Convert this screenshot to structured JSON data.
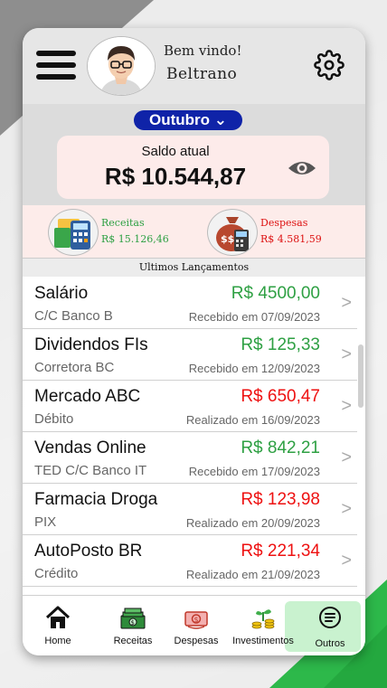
{
  "header": {
    "welcome": "Bem vindo!",
    "username": "Beltrano"
  },
  "month": {
    "label": "Outubro ⌄"
  },
  "balance": {
    "label": "Saldo atual",
    "value": "R$ 10.544,87"
  },
  "summary": {
    "income_title": "Receitas",
    "income_value": "R$ 15.126,46",
    "expense_title": "Despesas",
    "expense_value": "R$ 4.581,59"
  },
  "list_title": "Ultimos Lançamentos",
  "transactions": [
    {
      "name": "Salário",
      "account": "C/C Banco B",
      "amount": "R$ 4500,00",
      "status": "Recebido em 07/09/2023",
      "type": "income"
    },
    {
      "name": "Dividendos FIs",
      "account": "Corretora BC",
      "amount": "R$ 125,33",
      "status": "Recebido em 12/09/2023",
      "type": "income"
    },
    {
      "name": "Mercado ABC",
      "account": "Débito",
      "amount": "R$ 650,47",
      "status": "Realizado em 16/09/2023",
      "type": "expense"
    },
    {
      "name": "Vendas Online",
      "account": "TED C/C Banco IT",
      "amount": "R$ 842,21",
      "status": "Recebido em 17/09/2023",
      "type": "income"
    },
    {
      "name": "Farmacia Droga",
      "account": "PIX",
      "amount": "R$ 123,98",
      "status": "Realizado em 20/09/2023",
      "type": "expense"
    },
    {
      "name": "AutoPosto BR",
      "account": "Crédito",
      "amount": "R$ 221,34",
      "status": "Realizado em 21/09/2023",
      "type": "expense"
    }
  ],
  "chevron": ">",
  "nav": {
    "home": "Home",
    "receitas": "Receitas",
    "despesas": "Despesas",
    "investimentos": "Investimentos",
    "outros": "Outros",
    "active": "outros"
  },
  "colors": {
    "income": "#2ea043",
    "expense": "#e11111",
    "month_pill": "#0f23a8",
    "active_nav": "#c9f2cf"
  }
}
